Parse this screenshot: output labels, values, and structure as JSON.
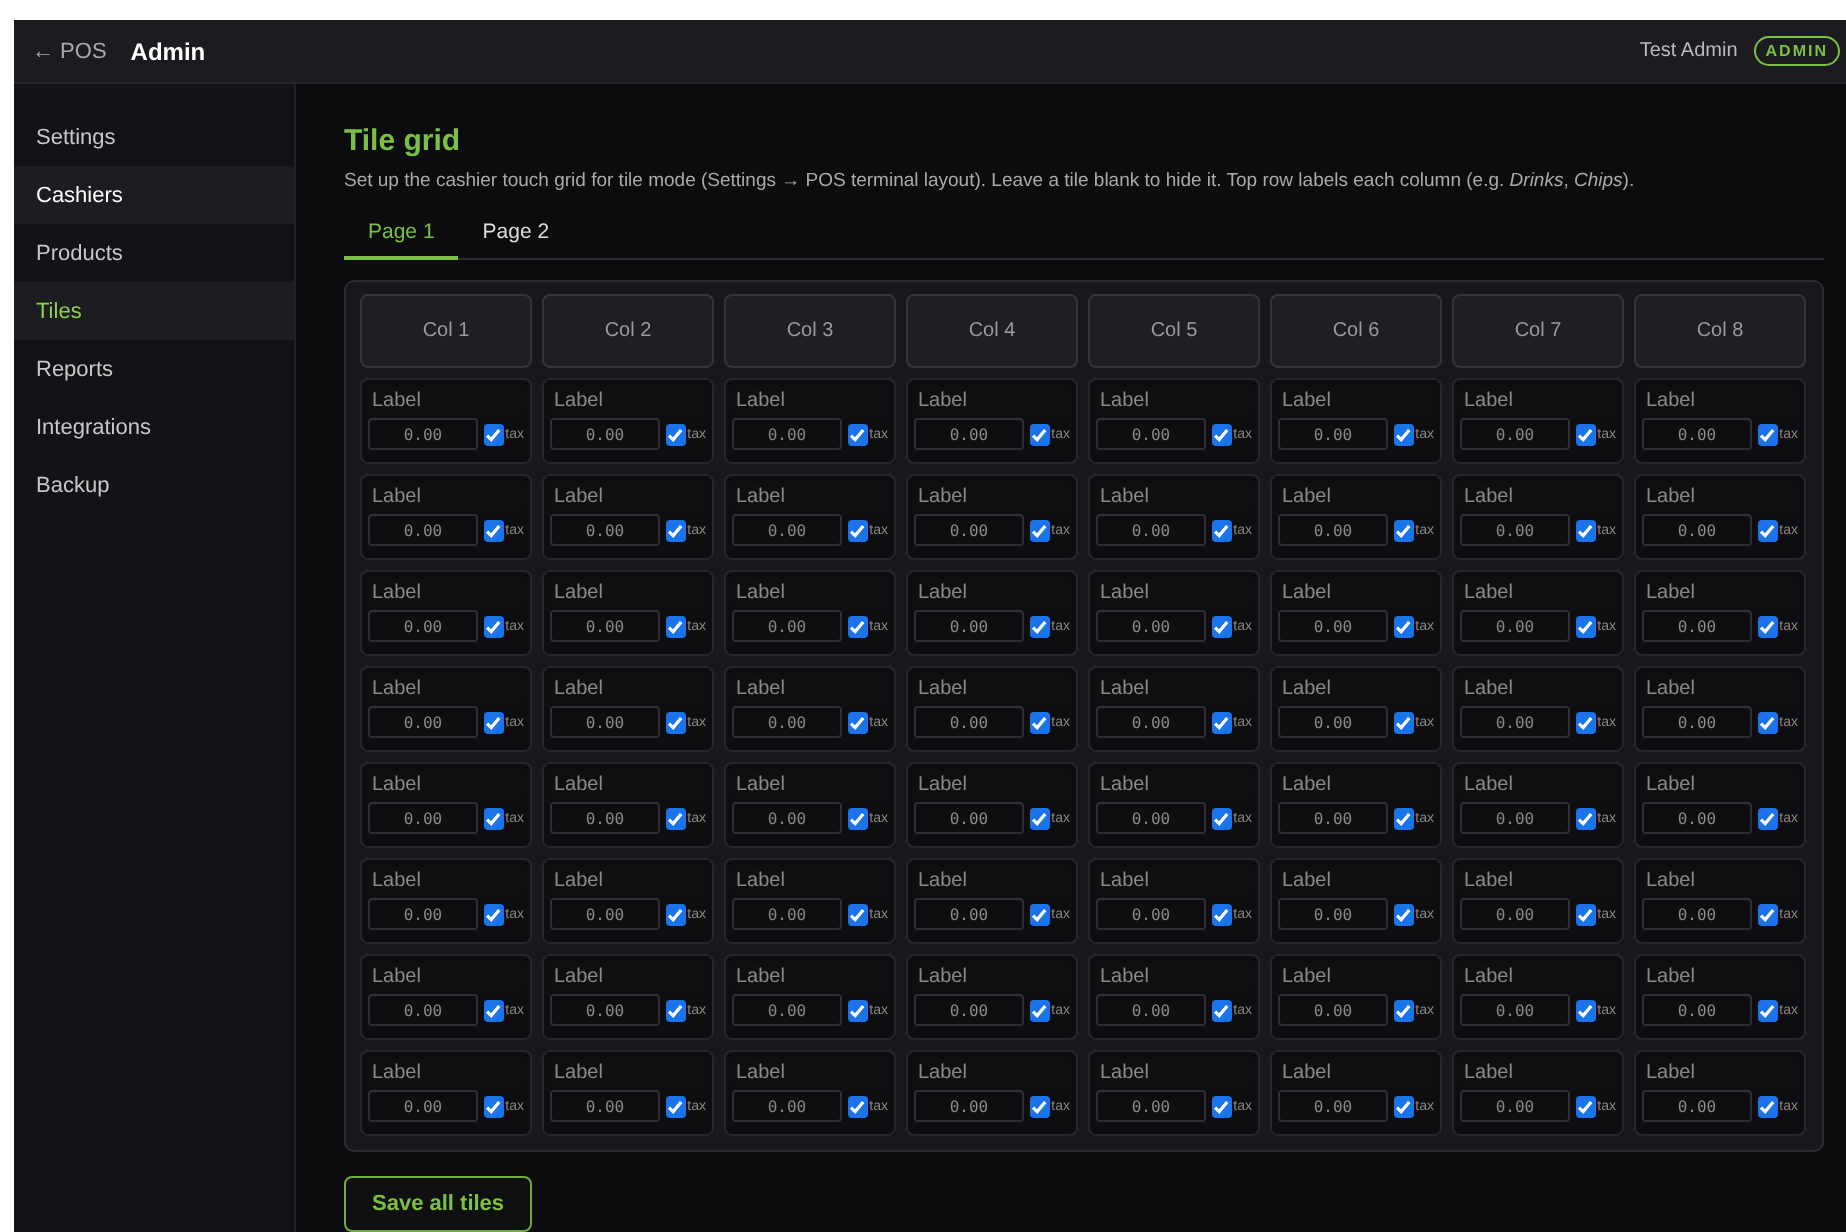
{
  "topbar": {
    "back_link": "← POS",
    "title": "Admin",
    "user": "Test Admin",
    "role_badge": "ADMIN"
  },
  "sidebar": {
    "items": [
      {
        "label": "Settings",
        "selected": false,
        "hovered": false
      },
      {
        "label": "Cashiers",
        "selected": false,
        "hovered": true
      },
      {
        "label": "Products",
        "selected": false,
        "hovered": false
      },
      {
        "label": "Tiles",
        "selected": true,
        "hovered": false
      },
      {
        "label": "Reports",
        "selected": false,
        "hovered": false
      },
      {
        "label": "Integrations",
        "selected": false,
        "hovered": false
      },
      {
        "label": "Backup",
        "selected": false,
        "hovered": false
      }
    ]
  },
  "page": {
    "title": "Tile grid",
    "description": "Set up the cashier touch grid for tile mode (Settings → POS terminal layout). Leave a tile blank to hide it. Top row labels each column (e.g. *Drinks*, *Chips*).",
    "tabs": [
      {
        "label": "Page 1",
        "selected": true
      },
      {
        "label": "Page 2",
        "selected": false
      }
    ],
    "grid": {
      "columns": [
        {
          "placeholder": "Col 1"
        },
        {
          "placeholder": "Col 2"
        },
        {
          "placeholder": "Col 3"
        },
        {
          "placeholder": "Col 4"
        },
        {
          "placeholder": "Col 5"
        },
        {
          "placeholder": "Col 6"
        },
        {
          "placeholder": "Col 7"
        },
        {
          "placeholder": "Col 8"
        }
      ],
      "rows": [
        {
          "tiles": [
            {
              "label_placeholder": "Label",
              "price_placeholder": "0.00",
              "tax": true,
              "tax_label": "tax"
            },
            {
              "label_placeholder": "Label",
              "price_placeholder": "0.00",
              "tax": true,
              "tax_label": "tax"
            },
            {
              "label_placeholder": "Label",
              "price_placeholder": "0.00",
              "tax": true,
              "tax_label": "tax"
            },
            {
              "label_placeholder": "Label",
              "price_placeholder": "0.00",
              "tax": true,
              "tax_label": "tax"
            },
            {
              "label_placeholder": "Label",
              "price_placeholder": "0.00",
              "tax": true,
              "tax_label": "tax"
            },
            {
              "label_placeholder": "Label",
              "price_placeholder": "0.00",
              "tax": true,
              "tax_label": "tax"
            },
            {
              "label_placeholder": "Label",
              "price_placeholder": "0.00",
              "tax": true,
              "tax_label": "tax"
            },
            {
              "label_placeholder": "Label",
              "price_placeholder": "0.00",
              "tax": true,
              "tax_label": "tax"
            }
          ]
        },
        {
          "tiles": [
            {
              "label_placeholder": "Label",
              "price_placeholder": "0.00",
              "tax": true,
              "tax_label": "tax"
            },
            {
              "label_placeholder": "Label",
              "price_placeholder": "0.00",
              "tax": true,
              "tax_label": "tax"
            },
            {
              "label_placeholder": "Label",
              "price_placeholder": "0.00",
              "tax": true,
              "tax_label": "tax"
            },
            {
              "label_placeholder": "Label",
              "price_placeholder": "0.00",
              "tax": true,
              "tax_label": "tax"
            },
            {
              "label_placeholder": "Label",
              "price_placeholder": "0.00",
              "tax": true,
              "tax_label": "tax"
            },
            {
              "label_placeholder": "Label",
              "price_placeholder": "0.00",
              "tax": true,
              "tax_label": "tax"
            },
            {
              "label_placeholder": "Label",
              "price_placeholder": "0.00",
              "tax": true,
              "tax_label": "tax"
            },
            {
              "label_placeholder": "Label",
              "price_placeholder": "0.00",
              "tax": true,
              "tax_label": "tax"
            }
          ]
        },
        {
          "tiles": [
            {
              "label_placeholder": "Label",
              "price_placeholder": "0.00",
              "tax": true,
              "tax_label": "tax"
            },
            {
              "label_placeholder": "Label",
              "price_placeholder": "0.00",
              "tax": true,
              "tax_label": "tax"
            },
            {
              "label_placeholder": "Label",
              "price_placeholder": "0.00",
              "tax": true,
              "tax_label": "tax"
            },
            {
              "label_placeholder": "Label",
              "price_placeholder": "0.00",
              "tax": true,
              "tax_label": "tax"
            },
            {
              "label_placeholder": "Label",
              "price_placeholder": "0.00",
              "tax": true,
              "tax_label": "tax"
            },
            {
              "label_placeholder": "Label",
              "price_placeholder": "0.00",
              "tax": true,
              "tax_label": "tax"
            },
            {
              "label_placeholder": "Label",
              "price_placeholder": "0.00",
              "tax": true,
              "tax_label": "tax"
            },
            {
              "label_placeholder": "Label",
              "price_placeholder": "0.00",
              "tax": true,
              "tax_label": "tax"
            }
          ]
        },
        {
          "tiles": [
            {
              "label_placeholder": "Label",
              "price_placeholder": "0.00",
              "tax": true,
              "tax_label": "tax"
            },
            {
              "label_placeholder": "Label",
              "price_placeholder": "0.00",
              "tax": true,
              "tax_label": "tax"
            },
            {
              "label_placeholder": "Label",
              "price_placeholder": "0.00",
              "tax": true,
              "tax_label": "tax"
            },
            {
              "label_placeholder": "Label",
              "price_placeholder": "0.00",
              "tax": true,
              "tax_label": "tax"
            },
            {
              "label_placeholder": "Label",
              "price_placeholder": "0.00",
              "tax": true,
              "tax_label": "tax"
            },
            {
              "label_placeholder": "Label",
              "price_placeholder": "0.00",
              "tax": true,
              "tax_label": "tax"
            },
            {
              "label_placeholder": "Label",
              "price_placeholder": "0.00",
              "tax": true,
              "tax_label": "tax"
            },
            {
              "label_placeholder": "Label",
              "price_placeholder": "0.00",
              "tax": true,
              "tax_label": "tax"
            }
          ]
        },
        {
          "tiles": [
            {
              "label_placeholder": "Label",
              "price_placeholder": "0.00",
              "tax": true,
              "tax_label": "tax"
            },
            {
              "label_placeholder": "Label",
              "price_placeholder": "0.00",
              "tax": true,
              "tax_label": "tax"
            },
            {
              "label_placeholder": "Label",
              "price_placeholder": "0.00",
              "tax": true,
              "tax_label": "tax"
            },
            {
              "label_placeholder": "Label",
              "price_placeholder": "0.00",
              "tax": true,
              "tax_label": "tax"
            },
            {
              "label_placeholder": "Label",
              "price_placeholder": "0.00",
              "tax": true,
              "tax_label": "tax"
            },
            {
              "label_placeholder": "Label",
              "price_placeholder": "0.00",
              "tax": true,
              "tax_label": "tax"
            },
            {
              "label_placeholder": "Label",
              "price_placeholder": "0.00",
              "tax": true,
              "tax_label": "tax"
            },
            {
              "label_placeholder": "Label",
              "price_placeholder": "0.00",
              "tax": true,
              "tax_label": "tax"
            }
          ]
        },
        {
          "tiles": [
            {
              "label_placeholder": "Label",
              "price_placeholder": "0.00",
              "tax": true,
              "tax_label": "tax"
            },
            {
              "label_placeholder": "Label",
              "price_placeholder": "0.00",
              "tax": true,
              "tax_label": "tax"
            },
            {
              "label_placeholder": "Label",
              "price_placeholder": "0.00",
              "tax": true,
              "tax_label": "tax"
            },
            {
              "label_placeholder": "Label",
              "price_placeholder": "0.00",
              "tax": true,
              "tax_label": "tax"
            },
            {
              "label_placeholder": "Label",
              "price_placeholder": "0.00",
              "tax": true,
              "tax_label": "tax"
            },
            {
              "label_placeholder": "Label",
              "price_placeholder": "0.00",
              "tax": true,
              "tax_label": "tax"
            },
            {
              "label_placeholder": "Label",
              "price_placeholder": "0.00",
              "tax": true,
              "tax_label": "tax"
            },
            {
              "label_placeholder": "Label",
              "price_placeholder": "0.00",
              "tax": true,
              "tax_label": "tax"
            }
          ]
        },
        {
          "tiles": [
            {
              "label_placeholder": "Label",
              "price_placeholder": "0.00",
              "tax": true,
              "tax_label": "tax"
            },
            {
              "label_placeholder": "Label",
              "price_placeholder": "0.00",
              "tax": true,
              "tax_label": "tax"
            },
            {
              "label_placeholder": "Label",
              "price_placeholder": "0.00",
              "tax": true,
              "tax_label": "tax"
            },
            {
              "label_placeholder": "Label",
              "price_placeholder": "0.00",
              "tax": true,
              "tax_label": "tax"
            },
            {
              "label_placeholder": "Label",
              "price_placeholder": "0.00",
              "tax": true,
              "tax_label": "tax"
            },
            {
              "label_placeholder": "Label",
              "price_placeholder": "0.00",
              "tax": true,
              "tax_label": "tax"
            },
            {
              "label_placeholder": "Label",
              "price_placeholder": "0.00",
              "tax": true,
              "tax_label": "tax"
            },
            {
              "label_placeholder": "Label",
              "price_placeholder": "0.00",
              "tax": true,
              "tax_label": "tax"
            }
          ]
        },
        {
          "tiles": [
            {
              "label_placeholder": "Label",
              "price_placeholder": "0.00",
              "tax": true,
              "tax_label": "tax"
            },
            {
              "label_placeholder": "Label",
              "price_placeholder": "0.00",
              "tax": true,
              "tax_label": "tax"
            },
            {
              "label_placeholder": "Label",
              "price_placeholder": "0.00",
              "tax": true,
              "tax_label": "tax"
            },
            {
              "label_placeholder": "Label",
              "price_placeholder": "0.00",
              "tax": true,
              "tax_label": "tax"
            },
            {
              "label_placeholder": "Label",
              "price_placeholder": "0.00",
              "tax": true,
              "tax_label": "tax"
            },
            {
              "label_placeholder": "Label",
              "price_placeholder": "0.00",
              "tax": true,
              "tax_label": "tax"
            },
            {
              "label_placeholder": "Label",
              "price_placeholder": "0.00",
              "tax": true,
              "tax_label": "tax"
            },
            {
              "label_placeholder": "Label",
              "price_placeholder": "0.00",
              "tax": true,
              "tax_label": "tax"
            }
          ]
        }
      ]
    },
    "save_button": "Save all tiles"
  }
}
